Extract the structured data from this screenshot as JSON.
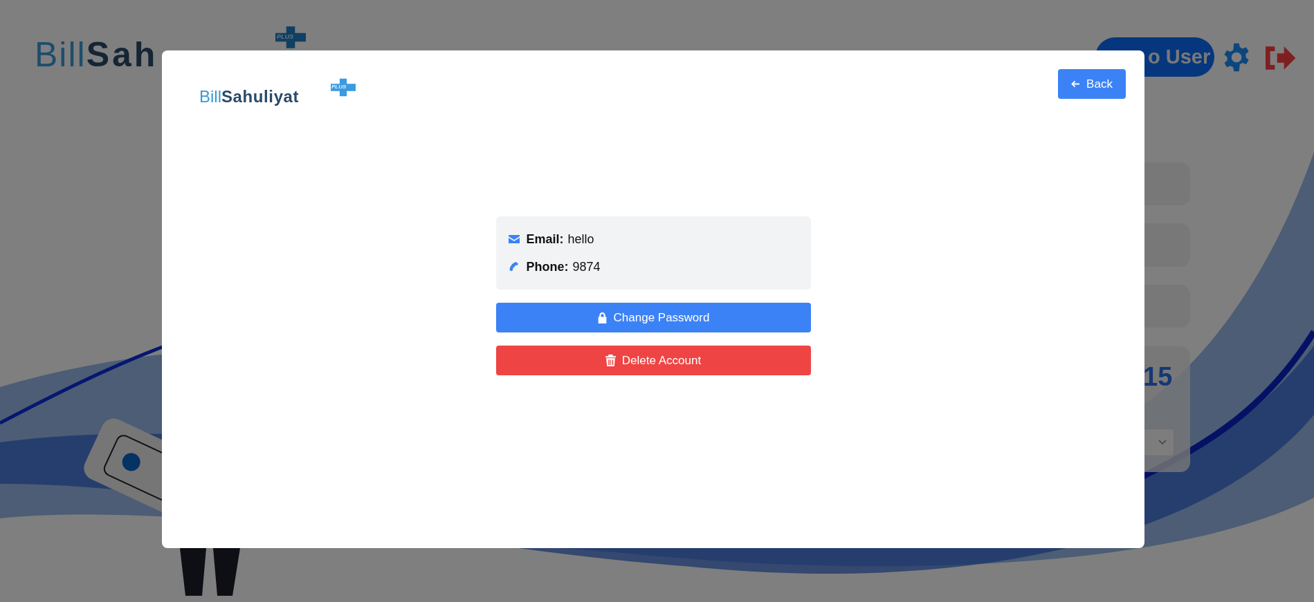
{
  "background_page": {
    "logo": {
      "brand_light": "Bill",
      "brand_bold": "Sah",
      "badge": "PLUS"
    },
    "user_button": "o User",
    "stat_value": "15"
  },
  "modal": {
    "logo": {
      "brand_light": "Bill",
      "brand_bold": "Sahuliyat",
      "badge": "PLUS"
    },
    "back_button": "Back",
    "contact": [
      {
        "kind": "email",
        "label": "Email:",
        "value": "hello"
      },
      {
        "kind": "phone",
        "label": "Phone:",
        "value": "9874"
      }
    ],
    "actions": [
      {
        "kind": "primary",
        "label": "Change Password"
      },
      {
        "kind": "danger",
        "label": "Delete Account"
      }
    ]
  }
}
